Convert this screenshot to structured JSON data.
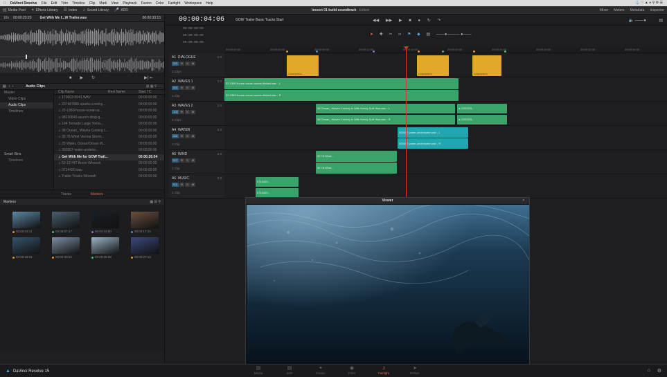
{
  "menubar": {
    "apple_icon": "apple-icon",
    "app_name": "DaVinci Resolve",
    "items": [
      "File",
      "Edit",
      "Trim",
      "Timeline",
      "Clip",
      "Mark",
      "View",
      "Playback",
      "Fusion",
      "Color",
      "Fairlight",
      "Workspace",
      "Help"
    ]
  },
  "toolbar": {
    "media_pool": "Media Pool",
    "effects_library": "Effects Library",
    "index": "Index",
    "sound_library": "Sound Library",
    "adr": "ADR",
    "project_title": "lesson 01 build soundtrack",
    "project_status": "Edited",
    "mixer": "Mixer",
    "meters": "Meters",
    "metadata": "Metadata",
    "inspector": "Inspector"
  },
  "source": {
    "zoom": "18x",
    "timecode": "00:00:23:23",
    "clip_name": "Get With Me f...W Trailer.wav",
    "duration": "00:00:30:15"
  },
  "media_pool": {
    "title": "Audio Clips",
    "bins": [
      "Master",
      "Video Clips",
      "Audio Clips",
      "Timelines"
    ],
    "selected_bin": "Audio Clips",
    "smart_bins_label": "Smart Bins",
    "smart_timelines": "Timelines",
    "columns": [
      "Clip Name",
      "Reel Name",
      "Start TC"
    ],
    "clips": [
      {
        "name": "170603-0041.WAV",
        "tc": "00:00:00:00"
      },
      {
        "name": "207487885-sparks-s-red-g...",
        "tc": "00:00:00:00"
      },
      {
        "name": "22-1380-house-ocean-w...",
        "tc": "00:00:00:00"
      },
      {
        "name": "98230840-search-drop-g...",
        "tc": "00:00:00:00"
      },
      {
        "name": "194 Tornado Large Torna...",
        "tc": "00:00:00:00"
      },
      {
        "name": "38 Ocean_ Waves Coming I...",
        "tc": "00:00:00:00"
      },
      {
        "name": "30 78 Wind Vienna Storm...",
        "tc": "00:00:00:00"
      },
      {
        "name": "25 Water, Ocean/Ocean W...",
        "tc": "00:00:00:00"
      },
      {
        "name": "300307-water-underw...",
        "tc": "00:00:00:00"
      },
      {
        "name": "Get With Me for GOW Trail...",
        "tc": "00:00:26:04",
        "selected": true
      },
      {
        "name": "53-12 HIT Boom Whoosh",
        "tc": "00:00:00:00"
      },
      {
        "name": "0714420.wav",
        "tc": "00:00:00:00"
      },
      {
        "name": "Trailer Tracks Wooosh",
        "tc": "00:00:00:00"
      }
    ],
    "tabs": [
      "Tracks",
      "Markers"
    ],
    "active_tab": "Markers"
  },
  "markers_panel": {
    "title": "Markers",
    "items": [
      {
        "tc": "00:00:03:11",
        "color": "#e8902a",
        "thumb": "#5d87a3"
      },
      {
        "tc": "00:00:07:17",
        "color": "#3fc06d",
        "thumb": "#49606e"
      },
      {
        "tc": "00:00:14:00",
        "color": "#8d6fd1",
        "thumb": "#1a2026"
      },
      {
        "tc": "00:00:17:15",
        "color": "#3e8fd8",
        "thumb": "#6b5040"
      },
      {
        "tc": "00:00:18:01",
        "color": "#e8902a",
        "thumb": "#36546c"
      },
      {
        "tc": "00:00:20:24",
        "color": "#e8902a",
        "thumb": "#7b8fa3"
      },
      {
        "tc": "00:00:25:08",
        "color": "#3fc06d",
        "thumb": "#9ab4c6"
      },
      {
        "tc": "00:00:27:13",
        "color": "#e8902a",
        "thumb": "#3d4a80"
      }
    ]
  },
  "timeline": {
    "timecode": "00:00:04:06",
    "name": "GOW Trailer Basic Tracks Start",
    "tc_rows": [
      "00:00:00:00",
      "00:00:00:00",
      "00:00:00:00"
    ],
    "ruler": [
      "00:00:00:00",
      "00:00:04:00",
      "00:00:08:00",
      "00:00:12:00",
      "00:00:16:00",
      "00:00:20:00",
      "00:00:24:00",
      "00:00:28:00",
      "00:00:32:00",
      "00:00:36:00"
    ],
    "tracks": [
      {
        "id": "A1",
        "name": "DIALOGUE",
        "ch": "2.0",
        "vol": "0.0",
        "clips": "3 Clips"
      },
      {
        "id": "A2",
        "name": "WAVES 1",
        "ch": "2.0",
        "vol": "0.0",
        "clips": "1 Clip"
      },
      {
        "id": "A3",
        "name": "WAVES 2",
        "ch": "2.0",
        "vol": "-1.0",
        "clips": "2 Clips"
      },
      {
        "id": "A4",
        "name": "WATER",
        "ch": "2.0",
        "vol": "0.0",
        "clips": "1 Clip"
      },
      {
        "id": "A5",
        "name": "WIND",
        "ch": "2.0",
        "vol": "0.7",
        "clips": "1 Clip"
      },
      {
        "id": "A6",
        "name": "MUSIC",
        "ch": "2.0",
        "vol": "0.1",
        "clips": "1 Clip"
      }
    ],
    "clip_labels": {
      "dlg": "Characters",
      "w1a": "22-1380-house-ocean-waves-distant.wav - L",
      "w1b": "22-1380-house-ocean-waves-distant.wav - R",
      "w2a": "38 Ocean_ Waves Coming In With Heavy Surf Hiss.wav - L",
      "w2b": "38 Ocean_ Waves Coming In With Heavy Surf Hiss.wav - R",
      "w2c": "a-2200325...",
      "w2d": "a-2200325...",
      "wat_a": "300307-water-underwater.wav - L",
      "wat_b": "300307-water-underwater.wav - R",
      "wind_a": "30 78 Wind...",
      "wind_b": "30 78 Wind...",
      "mus_a": "0714420...",
      "mus_b": "0714420..."
    }
  },
  "viewer": {
    "title": "Viewer"
  },
  "pages": [
    "Media",
    "Edit",
    "Fusion",
    "Color",
    "Fairlight",
    "Deliver"
  ],
  "active_page": "Fairlight",
  "brand": "DaVinci Resolve 15"
}
